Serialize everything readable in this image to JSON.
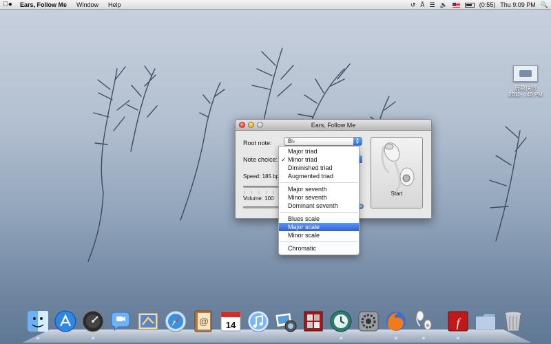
{
  "menubar": {
    "app_name": "Ears, Follow Me",
    "menus": [
      "Window",
      "Help"
    ],
    "battery": "(0:55)",
    "clock": "Thu 9:09 PM",
    "status_icons": [
      "time-machine-icon",
      "bluetooth-icon",
      "wifi-icon",
      "volume-icon",
      "us-flag-icon",
      "battery-icon",
      "spotlight-icon"
    ]
  },
  "desktop": {
    "file_label_line1": "屏幕快照",
    "file_label_line2": "2011-...46 PM"
  },
  "window": {
    "title": "Ears, Follow Me",
    "root_note_label": "Root note:",
    "root_note_value": "B♭",
    "note_choice_label": "Note choice:",
    "speed_label": "Speed: 185 bpm",
    "volume_label": "Volume:  100",
    "start_label": "Start"
  },
  "note_menu": {
    "checked": "Minor triad",
    "highlighted": "Major scale",
    "groups": [
      [
        "Major triad",
        "Minor triad",
        "Diminished triad",
        "Augmented triad"
      ],
      [
        "Major seventh",
        "Minor seventh",
        "Dominant seventh"
      ],
      [
        "Blues scale",
        "Major scale",
        "Minor scale"
      ],
      [
        "Chromatic"
      ]
    ]
  },
  "dock": {
    "calendar_day": "14",
    "apps": [
      "Finder",
      "App Store",
      "Dashboard",
      "iChat",
      "Mail",
      "Safari",
      "Address Book",
      "iCal",
      "iTunes",
      "iPhoto",
      "Photo Booth",
      "Time Machine",
      "System Preferences",
      "Firefox",
      "Ears, Follow Me",
      "Flash",
      "Documents",
      "Trash"
    ]
  },
  "colors": {
    "selection_blue": "#2a62d9",
    "desktop_top": "#c9d1de",
    "desktop_bottom": "#5f7894"
  }
}
